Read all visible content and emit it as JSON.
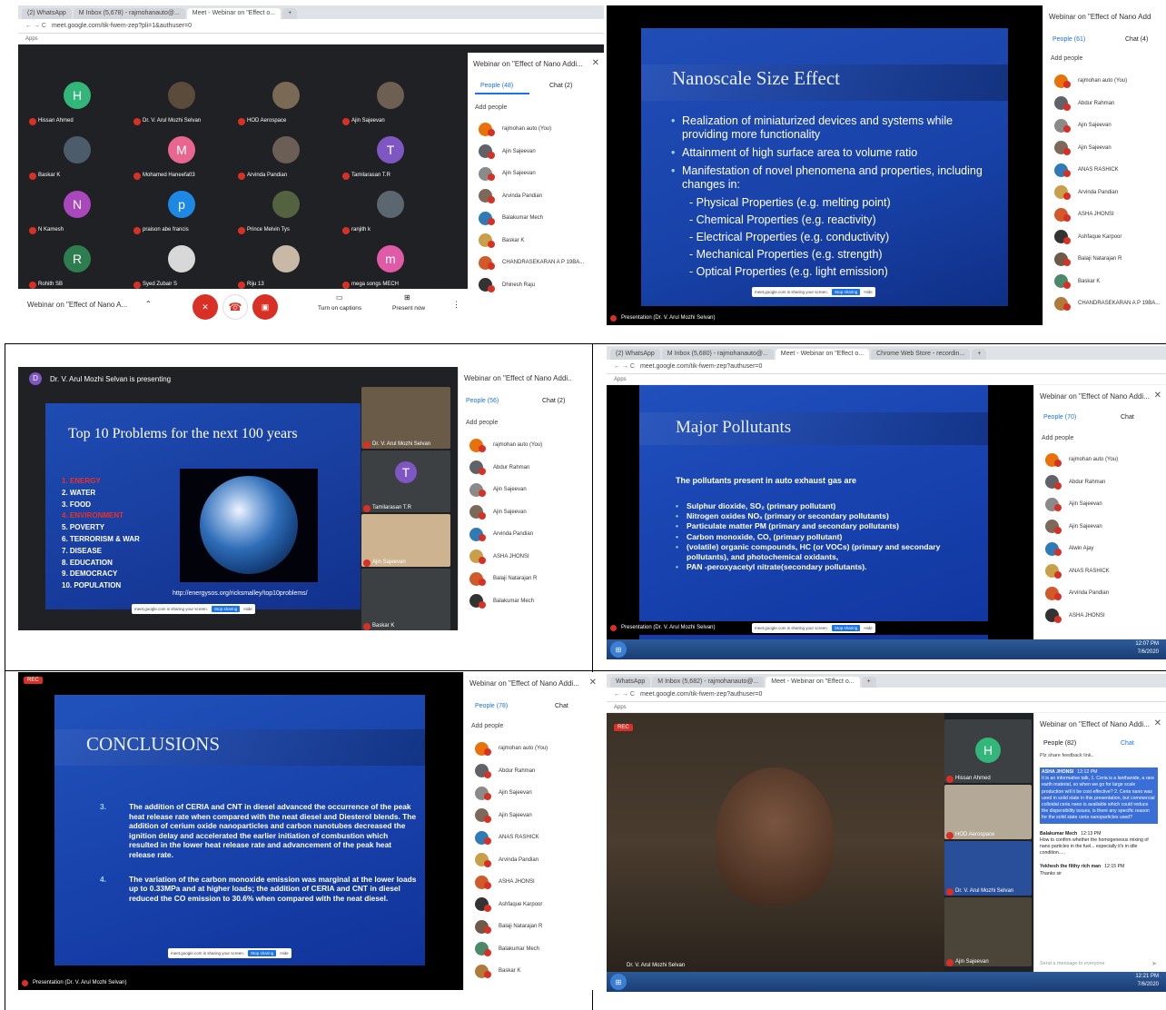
{
  "panels": {
    "p1": {
      "tabs": [
        "(2) WhatsApp",
        "M Inbox (5,678) - rajmohanauto@...",
        "Meet - Webinar on \"Effect o...",
        "+"
      ],
      "url": "meet.google.com/tik-fwem-zep?pli=1&authuser=0",
      "apps": "Apps",
      "tiles": [
        {
          "initial": "H",
          "color": "#33b679",
          "name": "Hissan Ahmed"
        },
        {
          "initial": "",
          "color": "#5a4b3a",
          "name": "Dr. V. Arul Mozhi Selvan"
        },
        {
          "initial": "",
          "color": "#7a6a55",
          "name": "HOD Aerospace"
        },
        {
          "initial": "",
          "color": "#6d6052",
          "name": "Ajin Sajeevan"
        },
        {
          "initial": "",
          "color": "#4d5c6b",
          "name": "Baskar K"
        },
        {
          "initial": "M",
          "color": "#e8668f",
          "name": "Mohamed Haneefa03"
        },
        {
          "initial": "",
          "color": "#6b5e54",
          "name": "Arvinda Pandian"
        },
        {
          "initial": "T",
          "color": "#7e57c2",
          "name": "Tamilarasan T.R"
        },
        {
          "initial": "N",
          "color": "#ab47bc",
          "name": "N Kamesh"
        },
        {
          "initial": "p",
          "color": "#1e88e5",
          "name": "praison abe francis"
        },
        {
          "initial": "",
          "color": "#54623f",
          "name": "Prince Melvin Tys"
        },
        {
          "initial": "",
          "color": "#5c6670",
          "name": "ranjith k"
        },
        {
          "initial": "R",
          "color": "#2e7d4f",
          "name": "Rohith SB"
        },
        {
          "initial": "",
          "color": "#d8d8d8",
          "name": "Syed Zubair S"
        },
        {
          "initial": "",
          "color": "#c9b8a6",
          "name": "Riju 13"
        },
        {
          "initial": "m",
          "color": "#e05aa8",
          "name": "mega songs MECH"
        }
      ],
      "meeting_name": "Webinar on \"Effect of Nano A...",
      "captions": "Turn on captions",
      "present": "Present now",
      "sidebar": {
        "title": "Webinar on \"Effect of Nano Addi...",
        "people_tab": "People (48)",
        "chat_tab": "Chat (2)",
        "add": "Add people",
        "people": [
          "rajmohan auto (You)",
          "Ajin Sajeevan",
          "Ajin Sajeevan",
          "Arvinda Pandian",
          "Balakumar Mech",
          "Baskar K",
          "CHANDRASEKARAN A P 19BA...",
          "Dhinesh Raju"
        ]
      }
    },
    "p2": {
      "slide_title": "Nanoscale Size Effect",
      "bullets": [
        {
          "t": "Realization of miniaturized devices and systems while providing more functionality",
          "b": true
        },
        {
          "t": "Attainment of high surface area to volume ratio",
          "b": true
        },
        {
          "t": "Manifestation of novel phenomena and properties, including changes in:",
          "b": true
        },
        {
          "t": "- Physical Properties (e.g. melting point)",
          "b": false
        },
        {
          "t": "- Chemical Properties (e.g. reactivity)",
          "b": false
        },
        {
          "t": "- Electrical Properties (e.g. conductivity)",
          "b": false
        },
        {
          "t": "- Mechanical Properties (e.g. strength)",
          "b": false
        },
        {
          "t": "- Optical Properties (e.g. light emission)",
          "b": false
        }
      ],
      "share_text": "meet.google.com is sharing your screen.",
      "stop": "Stop sharing",
      "hide": "Hide",
      "presentation": "Presentation (Dr. V. Arul Mozhi Selvan)",
      "sidebar": {
        "title": "Webinar on \"Effect of Nano Addi...",
        "people_tab": "People (61)",
        "chat_tab": "Chat (4)",
        "add": "Add people",
        "people": [
          "rajmohan auto (You)",
          "Abdur Rahman",
          "Ajin Sajeevan",
          "Ajin Sajeevan",
          "ANAS RASHICK",
          "Arvinda Pandian",
          "ASHA JHONSI",
          "Ashfaque Karpoor",
          "Balaji Natarajan R",
          "Baskar K",
          "CHANDRASEKARAN A P 19BA..."
        ]
      }
    },
    "p3": {
      "presenting": "Dr. V. Arul Mozhi Selvan is presenting",
      "presenter_initial": "D",
      "slide_title": "Top 10 Problems for the next 100 years",
      "list": [
        "1.  ENERGY",
        "2.  WATER",
        "3.  FOOD",
        "4.  ENVIRONMENT",
        "5.  POVERTY",
        "6.  TERRORISM & WAR",
        "7.  DISEASE",
        "8.  EDUCATION",
        "9.  DEMOCRACY",
        "10. POPULATION"
      ],
      "url_text": "http://energysos.org/ricksmalley/top10problems/",
      "share_text": "meet.google.com is sharing your screen.",
      "stop": "Stop sharing",
      "hide": "Hide",
      "strip": [
        "Dr. V. Arul Mozhi Selvan",
        "Tamilarasan T.R",
        "Ajin Sajeevan",
        "Baskar K"
      ],
      "strip_initial": "T",
      "sidebar": {
        "title": "Webinar on \"Effect of Nano Addi...",
        "people_tab": "People (56)",
        "chat_tab": "Chat (2)",
        "add": "Add people",
        "people": [
          "rajmohan auto (You)",
          "Abdur Rahman",
          "Ajin Sajeevan",
          "Ajin Sajeevan",
          "Arvinda Pandian",
          "ASHA JHONSI",
          "Balaji Natarajan R",
          "Balakumar Mech"
        ]
      }
    },
    "p4": {
      "tabs": [
        "(2) WhatsApp",
        "M Inbox (5,680) - rajmohanauto@...",
        "Meet - Webinar on \"Effect o...",
        "Chrome Web Store - recordin...",
        "+"
      ],
      "url": "meet.google.com/tik-fwem-zep?authuser=0",
      "apps": "Apps",
      "slide_title": "Major Pollutants",
      "intro": "The pollutants present in auto exhaust gas are",
      "bullets": [
        "Sulphur dioxide, SO₂ (primary pollutant)",
        "Nitrogen oxides NOₓ (primary or secondary pollutants)",
        "Particulate matter PM (primary and secondary pollutants)",
        "Carbon monoxide, CO, (primary pollutant)",
        "(volatile) organic compounds, HC (or VOCs) (primary and secondary pollutants), and photochemical oxidants,",
        "PAN -peroxyacetyl nitrate(secondary pollutants)."
      ],
      "presentation": "Presentation (Dr. V. Arul Mozhi Selvan)",
      "share_text": "meet.google.com is sharing your screen.",
      "stop": "Stop sharing",
      "hide": "Hide",
      "clock": "12:07 PM",
      "date": "7/6/2020",
      "sidebar": {
        "title": "Webinar on \"Effect of Nano Addi...",
        "people_tab": "People (70)",
        "chat_tab": "Chat",
        "add": "Add people",
        "people": [
          "rajmohan auto (You)",
          "Abdur Rahman",
          "Ajin Sajeevan",
          "Ajin Sajeevan",
          "Alwin Ajay",
          "ANAS RASHICK",
          "Arvinda Pandian",
          "ASHA JHONSI"
        ]
      }
    },
    "p5": {
      "rec": "REC",
      "slide_title": "CONCLUSIONS",
      "items": [
        {
          "n": "3.",
          "t": "The addition of CERIA and CNT in diesel advanced the occurrence of the peak heat release rate when compared with the neat diesel and Diesterol blends. The addition of cerium oxide nanoparticles and carbon nanotubes decreased the ignition delay and accelerated the earlier initiation of combustion which resulted in the lower heat release rate and advancement of the peak heat release rate."
        },
        {
          "n": "4.",
          "t": "The variation of the carbon monoxide emission was marginal at the lower loads up to 0.33MPa and at higher loads; the addition of CERIA and CNT in diesel reduced the CO emission to 30.6% when compared with the neat diesel."
        }
      ],
      "share_text": "meet.google.com is sharing your screen.",
      "stop": "Stop sharing",
      "hide": "Hide",
      "presentation": "Presentation (Dr. V. Arul Mozhi Selvan)",
      "sidebar": {
        "title": "Webinar on \"Effect of Nano Addi...",
        "people_tab": "People (78)",
        "chat_tab": "Chat",
        "add": "Add people",
        "people": [
          "rajmohan auto (You)",
          "Abdur Rahman",
          "Ajin Sajeevan",
          "Ajin Sajeevan",
          "ANAS RASHICK",
          "Arvinda Pandian",
          "ASHA JHONSI",
          "Ashfaque Karpoor",
          "Balaji Natarajan R",
          "Balakumar Mech",
          "Baskar K"
        ]
      }
    },
    "p6": {
      "tabs": [
        "WhatsApp",
        "M Inbox (5,682) - rajmohanauto@...",
        "Meet - Webinar on \"Effect o...",
        "+"
      ],
      "url": "meet.google.com/tik-fwem-zep?authuser=0",
      "apps": "Apps",
      "rec": "REC",
      "main_name": "Dr. V. Arul Mozhi Selvan",
      "strip": [
        "Hissan Ahmed",
        "HOD Aerospace",
        "Dr. V. Arul Mozhi Selvan",
        "Ajin Sajeevan"
      ],
      "strip_initial": "H",
      "clock": "12:21 PM",
      "date": "7/6/2020",
      "sidebar": {
        "title": "Webinar on \"Effect of Nano Addi...",
        "people_tab": "People (82)",
        "chat_tab": "Chat",
        "feedback": "Plz share feedback link..",
        "messages": [
          {
            "who": "ASHA JHONSI",
            "time": "12:12 PM",
            "text": "It is an informative talk, 1. Ceria is a lanthanide, a rare earth material, so when we go for large scale production will it be cost effective? 2. Ceria nano was used in solid state in this presentation, but commercial colloidal ceria nano is available which could reduce the dispersibility issues, is there any specific reason for the solid state ceria nanoparticles used?",
            "hl": true
          },
          {
            "who": "Balakumar Mech",
            "time": "12:13 PM",
            "text": "How to confirm whether the homogeneous mixing of nano particles in the fuel... especially it's in idle condition.....",
            "hl": false
          },
          {
            "who": "Yekhesh the filthy rich man",
            "time": "12:15 PM",
            "text": "Thanks sir",
            "hl": false
          }
        ],
        "input_placeholder": "Send a message to everyone"
      }
    }
  },
  "colors": {
    "accent": "#1a73e8",
    "danger": "#d93025",
    "meet_dark": "#202124"
  }
}
